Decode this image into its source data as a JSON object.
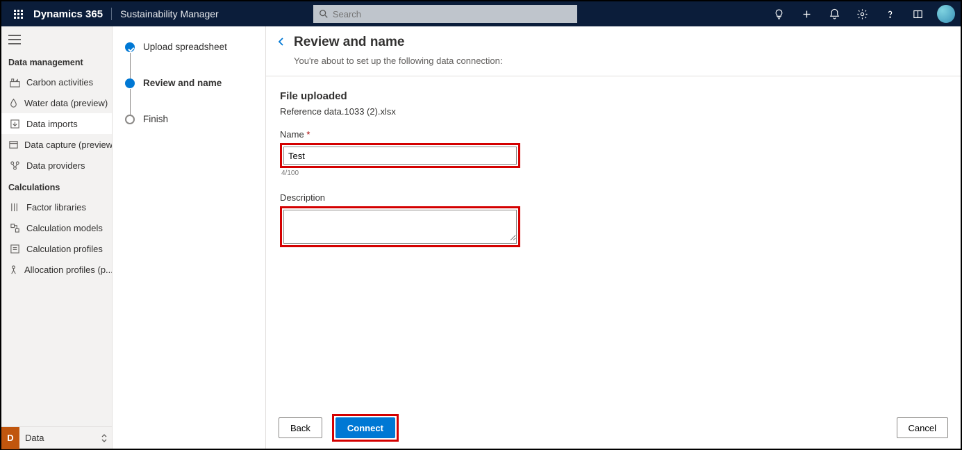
{
  "header": {
    "brand": "Dynamics 365",
    "module": "Sustainability Manager",
    "search_placeholder": "Search"
  },
  "sidebar": {
    "groups": [
      {
        "label": "Data management",
        "items": [
          {
            "label": "Carbon activities"
          },
          {
            "label": "Water data (preview)"
          },
          {
            "label": "Data imports"
          },
          {
            "label": "Data capture (preview)"
          },
          {
            "label": "Data providers"
          }
        ]
      },
      {
        "label": "Calculations",
        "items": [
          {
            "label": "Factor libraries"
          },
          {
            "label": "Calculation models"
          },
          {
            "label": "Calculation profiles"
          },
          {
            "label": "Allocation profiles (p..."
          }
        ]
      }
    ],
    "area_letter": "D",
    "area_name": "Data"
  },
  "stepper": {
    "steps": [
      {
        "state": "done",
        "label": "Upload spreadsheet"
      },
      {
        "state": "current",
        "label": "Review and name"
      },
      {
        "state": "pending",
        "label": "Finish"
      }
    ]
  },
  "page": {
    "title": "Review and name",
    "subtitle": "You're about to set up the following data connection:",
    "file_heading": "File uploaded",
    "filename": "Reference data.1033 (2).xlsx",
    "name_label": "Name",
    "name_value": "Test",
    "name_counter": "4/100",
    "desc_label": "Description",
    "desc_value": ""
  },
  "footer": {
    "back": "Back",
    "connect": "Connect",
    "cancel": "Cancel"
  }
}
